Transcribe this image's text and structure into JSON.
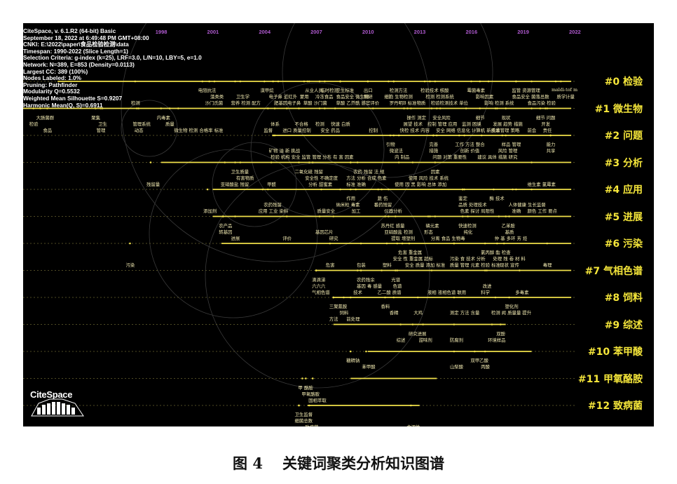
{
  "header_lines": [
    "CiteSpace, v. 6.1.R2 (64-bit) Basic",
    "September 18, 2022 at 6:49:48 PM GMT+08:00",
    "CNKI: E:\\2022\\paper\\食品检验检测\\data",
    "Timespan: 1990-2022 (Slice Length=1)",
    "Selection Criteria: g-index (k=25), LRF=3.0, L/N=10, LBY=5, e=1.0",
    "Network: N=389, E=853 (Density=0.0113)",
    "Largest CC: 389 (100%)",
    "Nodes Labeled: 1.0%",
    "Pruning: Pathfinder",
    "Modularity Q=0.5532",
    "Weighted Mean Silhouette S=0.9207",
    "Harmonic Mean(Q, S)=0.6911"
  ],
  "years": [
    "1998",
    "2001",
    "2004",
    "2007",
    "2010",
    "2013",
    "2016",
    "2019",
    "2022"
  ],
  "clusters": [
    {
      "label": "#0 检验",
      "start": 1992.0,
      "end": 2021.8
    },
    {
      "label": "#1 微生物",
      "start": 1990.0,
      "end": 2021.8
    },
    {
      "label": "#2 问题",
      "start": 2004.5,
      "end": 2021.8
    },
    {
      "label": "#3 分析",
      "start": 1998.0,
      "end": 2021.8
    },
    {
      "label": "#4 应用",
      "start": 2001.0,
      "end": 2021.8
    },
    {
      "label": "#5 进展",
      "start": 2001.0,
      "end": 2021.8
    },
    {
      "label": "#6 污染",
      "start": 2001.5,
      "end": 2021.8
    },
    {
      "label": "#7 气相色谱",
      "start": 2007.0,
      "end": 2021.8
    },
    {
      "label": "#8 饲料",
      "start": 2008.0,
      "end": 2021.8
    },
    {
      "label": "#9 综述",
      "start": 2008.0,
      "end": 2018.0
    },
    {
      "label": "#10 苯甲酸",
      "start": 2010.0,
      "end": 2019.5
    },
    {
      "label": "#11 甲氧酪胺",
      "start": 2009.0,
      "end": 2014.0
    },
    {
      "label": "#12 致病菌",
      "start": 2006.5,
      "end": 2013.0
    }
  ],
  "keywords": [
    {
      "c": 0,
      "row": 0,
      "year": 2000.4,
      "text": "电阻抗法"
    },
    {
      "c": 0,
      "row": 0,
      "year": 2004.0,
      "text": "漠甲烷"
    },
    {
      "c": 0,
      "row": 0,
      "year": 2006.6,
      "text": "从业人员"
    },
    {
      "c": 0,
      "row": 0,
      "year": 2007.5,
      "text": "临时检测"
    },
    {
      "c": 0,
      "row": 0,
      "year": 2008.4,
      "text": "卫生标准"
    },
    {
      "c": 0,
      "row": 0,
      "year": 2010.0,
      "text": "出口"
    },
    {
      "c": 0,
      "row": 0,
      "year": 2011.5,
      "text": "检测方法"
    },
    {
      "c": 0,
      "row": 0,
      "year": 2013.3,
      "text": "检验技术 核酸"
    },
    {
      "c": 0,
      "row": 0,
      "year": 2016.0,
      "text": "霉菌毒素"
    },
    {
      "c": 0,
      "row": 0,
      "year": 2018.6,
      "text": "监管 资源管理"
    },
    {
      "c": 0,
      "row": 0,
      "year": 2020.9,
      "text": "maldi-tof m"
    },
    {
      "c": 0,
      "row": 1,
      "year": 2001.1,
      "text": "藻类类"
    },
    {
      "c": 0,
      "row": 1,
      "year": 2002.6,
      "text": "卫生学"
    },
    {
      "c": 0,
      "row": 1,
      "year": 2004.5,
      "text": "电子鼻 近红外"
    },
    {
      "c": 0,
      "row": 1,
      "year": 2006.3,
      "text": "蒙用"
    },
    {
      "c": 0,
      "row": 1,
      "year": 2007.2,
      "text": "冷冻食品"
    },
    {
      "c": 0,
      "row": 1,
      "year": 2008.4,
      "text": "食品安全 微生物"
    },
    {
      "c": 0,
      "row": 1,
      "year": 2010.0,
      "text": "科研"
    },
    {
      "c": 0,
      "row": 1,
      "year": 2011.2,
      "text": "细胞 生物检测"
    },
    {
      "c": 0,
      "row": 1,
      "year": 2013.6,
      "text": "检测 检测系统"
    },
    {
      "c": 0,
      "row": 1,
      "year": 2016.5,
      "text": "影响因素"
    },
    {
      "c": 0,
      "row": 1,
      "year": 2018.6,
      "text": "食品安全 菌落总数"
    },
    {
      "c": 0,
      "row": 1,
      "year": 2021.2,
      "text": "质学计量"
    },
    {
      "c": 0,
      "row": 2,
      "year": 1996.5,
      "text": "检测"
    },
    {
      "c": 0,
      "row": 2,
      "year": 2000.8,
      "text": "沙门氏菌"
    },
    {
      "c": 0,
      "row": 2,
      "year": 2002.3,
      "text": "营养 检测 配方"
    },
    {
      "c": 0,
      "row": 2,
      "year": 2004.8,
      "text": "肥基因电子鼻"
    },
    {
      "c": 0,
      "row": 2,
      "year": 2006.5,
      "text": "草酸 沙门菌"
    },
    {
      "c": 0,
      "row": 2,
      "year": 2008.4,
      "text": "草酸 乙芥酰 感官评价"
    },
    {
      "c": 0,
      "row": 2,
      "year": 2011.5,
      "text": "罗丹明B 标准物质"
    },
    {
      "c": 0,
      "row": 2,
      "year": 2013.9,
      "text": "检验检测技术 单位"
    },
    {
      "c": 0,
      "row": 2,
      "year": 2017.0,
      "text": "影响 检测 系统"
    },
    {
      "c": 0,
      "row": 2,
      "year": 2019.5,
      "text": "食品污染 检验"
    },
    {
      "c": 1,
      "row": 0,
      "year": 1991.0,
      "text": "大肠菌群"
    },
    {
      "c": 1,
      "row": 0,
      "year": 1994.2,
      "text": "聚集"
    },
    {
      "c": 1,
      "row": 0,
      "year": 1998.0,
      "text": "内毒素"
    },
    {
      "c": 1,
      "row": 0,
      "year": 2012.5,
      "text": "操作 测定"
    },
    {
      "c": 1,
      "row": 0,
      "year": 2014.0,
      "text": "安全风险"
    },
    {
      "c": 1,
      "row": 0,
      "year": 2016.5,
      "text": "细节"
    },
    {
      "c": 1,
      "row": 0,
      "year": 2018.0,
      "text": "现状"
    },
    {
      "c": 1,
      "row": 0,
      "year": 2020.0,
      "text": "细节 问题"
    },
    {
      "c": 1,
      "row": 1,
      "year": 1990.6,
      "text": "检验"
    },
    {
      "c": 1,
      "row": 1,
      "year": 1994.6,
      "text": "卫生"
    },
    {
      "c": 1,
      "row": 1,
      "year": 1996.6,
      "text": "管理系统"
    },
    {
      "c": 1,
      "row": 1,
      "year": 1998.5,
      "text": "质量"
    },
    {
      "c": 1,
      "row": 1,
      "year": 2004.6,
      "text": "体系"
    },
    {
      "c": 1,
      "row": 1,
      "year": 2006.0,
      "text": "不合格"
    },
    {
      "c": 1,
      "row": 1,
      "year": 2007.2,
      "text": "检测"
    },
    {
      "c": 1,
      "row": 1,
      "year": 2008.1,
      "text": "快速 白质"
    },
    {
      "c": 1,
      "row": 1,
      "year": 2012.3,
      "text": "展望 技术"
    },
    {
      "c": 1,
      "row": 1,
      "year": 2013.7,
      "text": "控制 管理 应用"
    },
    {
      "c": 1,
      "row": 1,
      "year": 2015.7,
      "text": "监测 困境"
    },
    {
      "c": 1,
      "row": 1,
      "year": 2017.5,
      "text": "发展 趋势 措施"
    },
    {
      "c": 1,
      "row": 1,
      "year": 2020.3,
      "text": "开发"
    },
    {
      "c": 1,
      "row": 2,
      "year": 1991.4,
      "text": "食品"
    },
    {
      "c": 1,
      "row": 2,
      "year": 1994.5,
      "text": "管理"
    },
    {
      "c": 1,
      "row": 2,
      "year": 1996.7,
      "text": "动态"
    },
    {
      "c": 1,
      "row": 2,
      "year": 1999.0,
      "text": "微生物 检测 合格率 标准"
    },
    {
      "c": 1,
      "row": 2,
      "year": 2004.2,
      "text": "监督"
    },
    {
      "c": 1,
      "row": 2,
      "year": 2005.3,
      "text": "进口 质量控制"
    },
    {
      "c": 1,
      "row": 2,
      "year": 2007.5,
      "text": "安全 药品"
    },
    {
      "c": 1,
      "row": 2,
      "year": 2010.3,
      "text": "控制"
    },
    {
      "c": 1,
      "row": 2,
      "year": 2012.1,
      "text": "快检 技术 内容"
    },
    {
      "c": 1,
      "row": 2,
      "year": 2014.2,
      "text": "安全 网络 信息化 计算机 新技术"
    },
    {
      "c": 1,
      "row": 2,
      "year": 2017.4,
      "text": "质量管理 策略"
    },
    {
      "c": 1,
      "row": 2,
      "year": 2019.5,
      "text": "前会"
    },
    {
      "c": 1,
      "row": 2,
      "year": 2020.4,
      "text": "责任"
    },
    {
      "c": 2,
      "row": 0,
      "year": 2011.3,
      "text": "引物"
    },
    {
      "c": 2,
      "row": 0,
      "year": 2013.8,
      "text": "完善"
    },
    {
      "c": 2,
      "row": 0,
      "year": 2015.3,
      "text": "工作 方法 整合"
    },
    {
      "c": 2,
      "row": 0,
      "year": 2018.0,
      "text": "样品 管理"
    },
    {
      "c": 2,
      "row": 0,
      "year": 2020.6,
      "text": "能力"
    },
    {
      "c": 2,
      "row": 1,
      "year": 2004.5,
      "text": "矿物 油 新 挑战"
    },
    {
      "c": 2,
      "row": 1,
      "year": 2011.5,
      "text": "微波法"
    },
    {
      "c": 2,
      "row": 1,
      "year": 2013.8,
      "text": "措施"
    },
    {
      "c": 2,
      "row": 1,
      "year": 2015.6,
      "text": "创新 价值"
    },
    {
      "c": 2,
      "row": 1,
      "year": 2017.8,
      "text": "风险 管理"
    },
    {
      "c": 2,
      "row": 1,
      "year": 2020.6,
      "text": "共享"
    },
    {
      "c": 2,
      "row": 2,
      "year": 2004.6,
      "text": "检验 机构 安全 监管 管理 分布 有 害 因素"
    },
    {
      "c": 2,
      "row": 2,
      "year": 2011.8,
      "text": "内 制品"
    },
    {
      "c": 2,
      "row": 2,
      "year": 2014.0,
      "text": "问题 对策 重要性"
    },
    {
      "c": 2,
      "row": 2,
      "year": 2016.6,
      "text": "建议 具体 措施 研究"
    },
    {
      "c": 3,
      "row": 0,
      "year": 2002.3,
      "text": "卫生质量"
    },
    {
      "c": 3,
      "row": 0,
      "year": 2006.0,
      "text": "二氧化硫 残留"
    },
    {
      "c": 3,
      "row": 0,
      "year": 2009.4,
      "text": "农药 残留 法 规"
    },
    {
      "c": 3,
      "row": 0,
      "year": 2013.9,
      "text": "因素"
    },
    {
      "c": 3,
      "row": 1,
      "year": 2002.6,
      "text": "有害物质"
    },
    {
      "c": 3,
      "row": 1,
      "year": 2006.6,
      "text": "安全性 不确定度"
    },
    {
      "c": 3,
      "row": 1,
      "year": 2009.0,
      "text": "方法 分析 合成 色素"
    },
    {
      "c": 3,
      "row": 1,
      "year": 2012.6,
      "text": "使用 风险 技术 系统"
    },
    {
      "c": 3,
      "row": 2,
      "year": 1997.4,
      "text": "残留量"
    },
    {
      "c": 3,
      "row": 2,
      "year": 2001.7,
      "text": "亚硝酸盐 残留"
    },
    {
      "c": 3,
      "row": 2,
      "year": 2004.4,
      "text": "甲醛"
    },
    {
      "c": 3,
      "row": 2,
      "year": 2006.8,
      "text": "分析 甜蜜素"
    },
    {
      "c": 3,
      "row": 2,
      "year": 2009.0,
      "text": "标准 准确"
    },
    {
      "c": 3,
      "row": 2,
      "year": 2011.8,
      "text": "使用 因 黑 影响 总体 添加"
    },
    {
      "c": 3,
      "row": 2,
      "year": 2019.5,
      "text": "维生素 氯霉素"
    },
    {
      "c": 4,
      "row": 0,
      "year": 2009.0,
      "text": "作用"
    },
    {
      "c": 4,
      "row": 0,
      "year": 2010.8,
      "text": "蔬 伤"
    },
    {
      "c": 4,
      "row": 0,
      "year": 2015.5,
      "text": "鉴定"
    },
    {
      "c": 4,
      "row": 0,
      "year": 2017.3,
      "text": "酶 技术"
    },
    {
      "c": 4,
      "row": 1,
      "year": 2004.2,
      "text": "农药残留"
    },
    {
      "c": 4,
      "row": 1,
      "year": 2008.4,
      "text": "纳米粒 毒素"
    },
    {
      "c": 4,
      "row": 1,
      "year": 2010.6,
      "text": "番药残留"
    },
    {
      "c": 4,
      "row": 1,
      "year": 2015.5,
      "text": "品质 处理技术"
    },
    {
      "c": 4,
      "row": 1,
      "year": 2018.4,
      "text": "人体健康 生长监督"
    },
    {
      "c": 4,
      "row": 2,
      "year": 2000.7,
      "text": "添加剂"
    },
    {
      "c": 4,
      "row": 2,
      "year": 2003.9,
      "text": "应用 工业 染料"
    },
    {
      "c": 4,
      "row": 2,
      "year": 2007.3,
      "text": "质量安全"
    },
    {
      "c": 4,
      "row": 2,
      "year": 2009.3,
      "text": "加工"
    },
    {
      "c": 4,
      "row": 2,
      "year": 2011.2,
      "text": "仪器分析"
    },
    {
      "c": 4,
      "row": 2,
      "year": 2015.6,
      "text": "色素 探讨 局限性"
    },
    {
      "c": 4,
      "row": 2,
      "year": 2018.6,
      "text": "准确"
    },
    {
      "c": 4,
      "row": 2,
      "year": 2019.5,
      "text": "颜色 工作 要点"
    },
    {
      "c": 5,
      "row": 0,
      "year": 2001.6,
      "text": "农产品"
    },
    {
      "c": 5,
      "row": 0,
      "year": 2011.0,
      "text": "苏丹红 感量"
    },
    {
      "c": 5,
      "row": 0,
      "year": 2013.6,
      "text": "磷元素"
    },
    {
      "c": 5,
      "row": 0,
      "year": 2015.5,
      "text": "快速检测"
    },
    {
      "c": 5,
      "row": 0,
      "year": 2018.0,
      "text": "乙苯胺"
    },
    {
      "c": 5,
      "row": 1,
      "year": 2001.6,
      "text": "转基因"
    },
    {
      "c": 5,
      "row": 1,
      "year": 2007.2,
      "text": "基因芯片"
    },
    {
      "c": 5,
      "row": 1,
      "year": 2011.2,
      "text": "亚硝酸盐 检测"
    },
    {
      "c": 5,
      "row": 1,
      "year": 2013.5,
      "text": "形态"
    },
    {
      "c": 5,
      "row": 1,
      "year": 2015.8,
      "text": "纯化"
    },
    {
      "c": 5,
      "row": 1,
      "year": 2018.2,
      "text": "基质"
    },
    {
      "c": 5,
      "row": 2,
      "year": 2002.3,
      "text": "进展"
    },
    {
      "c": 5,
      "row": 2,
      "year": 2005.3,
      "text": "评价"
    },
    {
      "c": 5,
      "row": 2,
      "year": 2008.0,
      "text": "研究"
    },
    {
      "c": 5,
      "row": 2,
      "year": 2011.6,
      "text": "提取 增塑剂"
    },
    {
      "c": 5,
      "row": 2,
      "year": 2013.9,
      "text": "分离 食品 生物毒"
    },
    {
      "c": 5,
      "row": 2,
      "year": 2017.6,
      "text": "仲 基 多环 芳 烃"
    },
    {
      "c": 6,
      "row": 0,
      "year": 2012.0,
      "text": "危害 重金属"
    },
    {
      "c": 6,
      "row": 0,
      "year": 2016.8,
      "text": "氯丙醇 酯 检查"
    },
    {
      "c": 6,
      "row": 1,
      "year": 2011.7,
      "text": "安全 性 重金属 超标"
    },
    {
      "c": 6,
      "row": 1,
      "year": 2015.0,
      "text": "污染 食 技术 分析"
    },
    {
      "c": 6,
      "row": 1,
      "year": 2017.5,
      "text": "处理 残 卷 材 料"
    },
    {
      "c": 6,
      "row": 2,
      "year": 1996.2,
      "text": "污染"
    },
    {
      "c": 6,
      "row": 2,
      "year": 2007.8,
      "text": "危害"
    },
    {
      "c": 6,
      "row": 2,
      "year": 2009.6,
      "text": "包装"
    },
    {
      "c": 6,
      "row": 2,
      "year": 2011.1,
      "text": "塑料"
    },
    {
      "c": 6,
      "row": 2,
      "year": 2012.4,
      "text": "安全 质量 添加 标准"
    },
    {
      "c": 6,
      "row": 2,
      "year": 2015.0,
      "text": "质量 管理 元素 检验 标准"
    },
    {
      "c": 6,
      "row": 2,
      "year": 2017.9,
      "text": "现状 宣传"
    },
    {
      "c": 6,
      "row": 2,
      "year": 2020.4,
      "text": "毒理"
    },
    {
      "c": 7,
      "row": 0,
      "year": 2007.0,
      "text": "滴滴涕"
    },
    {
      "c": 7,
      "row": 0,
      "year": 2009.6,
      "text": "农药残余"
    },
    {
      "c": 7,
      "row": 0,
      "year": 2011.6,
      "text": "光谱"
    },
    {
      "c": 7,
      "row": 1,
      "year": 2007.0,
      "text": "六六六"
    },
    {
      "c": 7,
      "row": 1,
      "year": 2009.6,
      "text": "基因 毒 感量"
    },
    {
      "c": 7,
      "row": 1,
      "year": 2011.7,
      "text": "色谱"
    },
    {
      "c": 7,
      "row": 1,
      "year": 2016.9,
      "text": "改进"
    },
    {
      "c": 7,
      "row": 2,
      "year": 2007.0,
      "text": "气相色谱"
    },
    {
      "c": 7,
      "row": 2,
      "year": 2009.4,
      "text": "技术"
    },
    {
      "c": 7,
      "row": 2,
      "year": 2010.8,
      "text": "乙二酸 质谱"
    },
    {
      "c": 7,
      "row": 2,
      "year": 2013.7,
      "text": "液相 液相色谱 联用"
    },
    {
      "c": 7,
      "row": 2,
      "year": 2016.8,
      "text": "科学"
    },
    {
      "c": 7,
      "row": 2,
      "year": 2018.8,
      "text": "多毒素"
    },
    {
      "c": 8,
      "row": 0,
      "year": 2008.0,
      "text": "三聚氰胺"
    },
    {
      "c": 8,
      "row": 0,
      "year": 2011.0,
      "text": "香料"
    },
    {
      "c": 8,
      "row": 0,
      "year": 2018.2,
      "text": "塑化剂"
    },
    {
      "c": 8,
      "row": 1,
      "year": 2008.6,
      "text": "饲料"
    },
    {
      "c": 8,
      "row": 1,
      "year": 2011.5,
      "text": "香精"
    },
    {
      "c": 8,
      "row": 1,
      "year": 2012.9,
      "text": "大鸡"
    },
    {
      "c": 8,
      "row": 1,
      "year": 2015.0,
      "text": "测定 方法 含量"
    },
    {
      "c": 8,
      "row": 1,
      "year": 2017.4,
      "text": "检测 闻 质量量 提升"
    },
    {
      "c": 8,
      "row": 2,
      "year": 2008.0,
      "text": "方法"
    },
    {
      "c": 8,
      "row": 2,
      "year": 2009.0,
      "text": "前处理"
    },
    {
      "c": 9,
      "row": 0,
      "year": 2012.6,
      "text": "研究进展"
    },
    {
      "c": 9,
      "row": 0,
      "year": 2017.7,
      "text": "双酚"
    },
    {
      "c": 9,
      "row": 1,
      "year": 2011.9,
      "text": "综述"
    },
    {
      "c": 9,
      "row": 1,
      "year": 2013.2,
      "text": "甜味剂"
    },
    {
      "c": 9,
      "row": 1,
      "year": 2015.0,
      "text": "防腐剂"
    },
    {
      "c": 9,
      "row": 1,
      "year": 2017.2,
      "text": "环境样品"
    },
    {
      "c": 10,
      "row": 0,
      "year": 2009.0,
      "text": "糖精钠"
    },
    {
      "c": 10,
      "row": 0,
      "year": 2016.2,
      "text": "双甲乙酸"
    },
    {
      "c": 10,
      "row": 1,
      "year": 2009.9,
      "text": "苯甲酸"
    },
    {
      "c": 10,
      "row": 1,
      "year": 2015.0,
      "text": "山梨酸"
    },
    {
      "c": 10,
      "row": 1,
      "year": 2016.8,
      "text": "丙酸"
    },
    {
      "c": 11,
      "row": 0,
      "year": 2006.2,
      "text": "甲 酪胺"
    },
    {
      "c": 11,
      "row": 1,
      "year": 2006.4,
      "text": "甲氧酪胺"
    },
    {
      "c": 11,
      "row": 2,
      "year": 2006.8,
      "text": "固相萃取"
    },
    {
      "c": 12,
      "row": 0,
      "year": 2006.0,
      "text": "卫生监督"
    },
    {
      "c": 12,
      "row": 1,
      "year": 2006.0,
      "text": "细菌总数"
    },
    {
      "c": 12,
      "row": 2,
      "year": 2006.6,
      "text": "致病菌"
    },
    {
      "c": 12,
      "row": 2,
      "year": 2012.5,
      "text": "食源性"
    }
  ],
  "logo": {
    "text": "CiteSpace"
  },
  "caption": {
    "number": "图 4",
    "title": "关键词聚类分析知识图谱"
  },
  "colors": {
    "background": "#000000",
    "timeline": "#f0e04a",
    "label": "#f5e63a",
    "year": "#b05ad0",
    "keyword": "#f0e8b0"
  }
}
